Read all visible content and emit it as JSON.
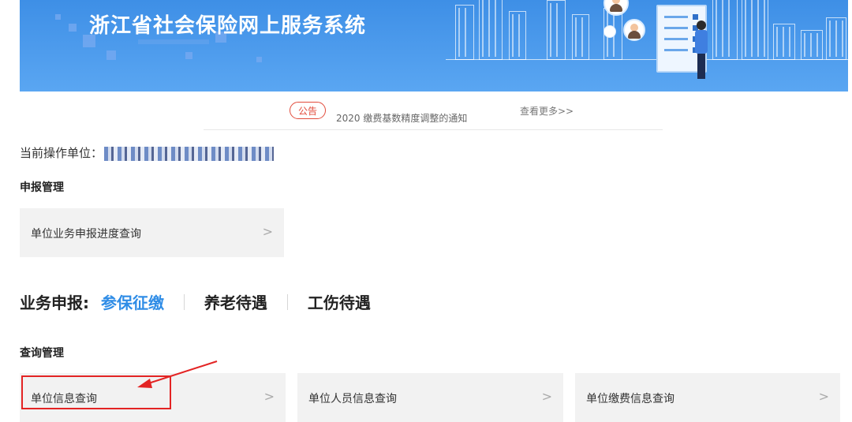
{
  "header": {
    "title": "浙江省社会保险网上服务系统"
  },
  "notice": {
    "badge": "公告",
    "text": "2020 缴费基数精度调整的通知",
    "more": "查看更多>>"
  },
  "current_unit": {
    "label": "当前操作单位："
  },
  "declare_mgmt": {
    "title": "申报管理",
    "items": [
      {
        "label": "单位业务申报进度查询",
        "chevron": ">"
      }
    ]
  },
  "business_declare": {
    "label": "业务申报:",
    "tabs": [
      {
        "label": "参保征缴",
        "active": true
      },
      {
        "label": "养老待遇",
        "active": false
      },
      {
        "label": "工伤待遇",
        "active": false
      }
    ]
  },
  "query_mgmt": {
    "title": "查询管理",
    "items": [
      {
        "label": "单位信息查询",
        "chevron": ">"
      },
      {
        "label": "单位人员信息查询",
        "chevron": ">"
      },
      {
        "label": "单位缴费信息查询",
        "chevron": ">"
      }
    ]
  },
  "colors": {
    "banner": "#4a9aeb",
    "accent": "#2e8ce6",
    "annotation": "#e32424",
    "card_bg": "#f2f2f2"
  },
  "icons": [
    "chevron-right-icon",
    "arrow-annotation-icon"
  ]
}
